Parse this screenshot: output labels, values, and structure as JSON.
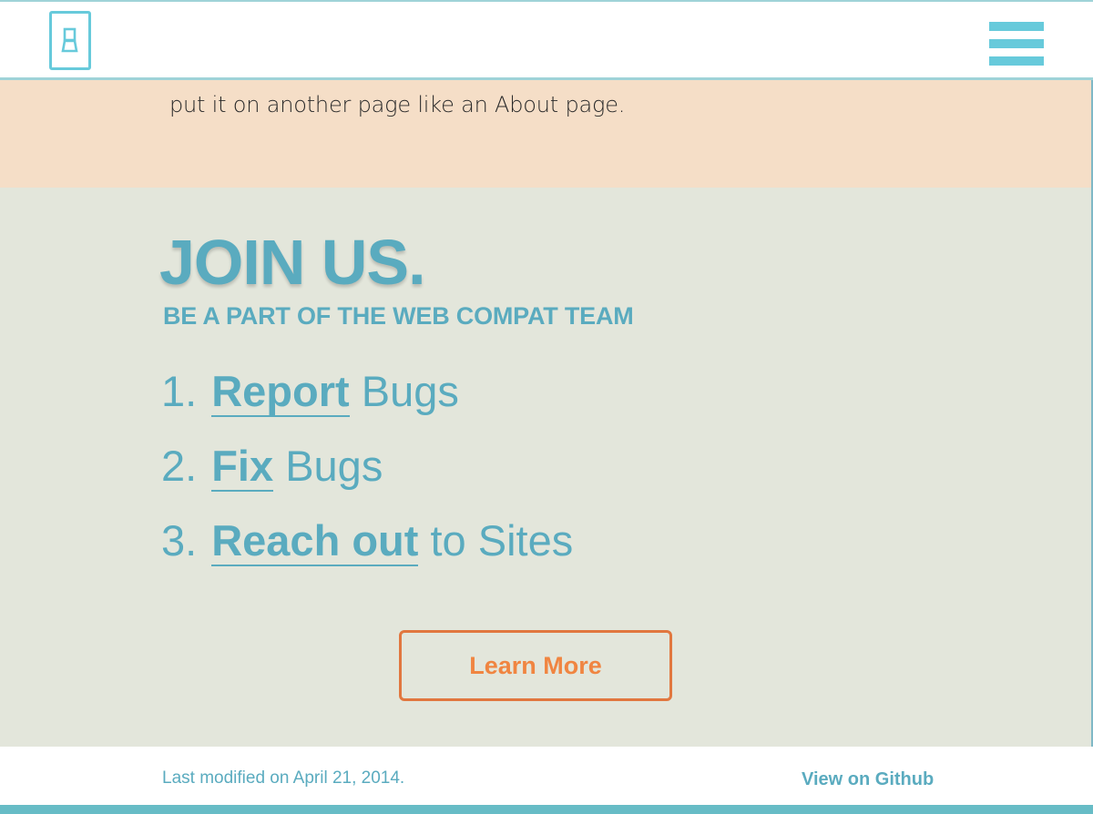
{
  "header": {
    "logo_icon": "lightswitch-logo-icon",
    "menu_icon": "hamburger-menu-icon"
  },
  "intro": {
    "text": "put it on another page like an About page."
  },
  "join": {
    "title": "JOIN US.",
    "subtitle": "BE A PART OF THE WEB COMPAT TEAM",
    "steps": [
      {
        "number": "1.",
        "link": "Report",
        "rest": "Bugs"
      },
      {
        "number": "2.",
        "link": "Fix",
        "rest": "Bugs"
      },
      {
        "number": "3.",
        "link": "Reach out",
        "rest": "to Sites"
      }
    ],
    "button_label": "Learn More"
  },
  "footer": {
    "modified": "Last modified on April 21, 2014.",
    "github_link": "View on Github"
  },
  "colors": {
    "accent_teal": "#5aabbf",
    "light_teal": "#67cadb",
    "button_orange": "#f08541",
    "intro_bg": "#f5dec7",
    "join_bg": "#e3e6db"
  }
}
